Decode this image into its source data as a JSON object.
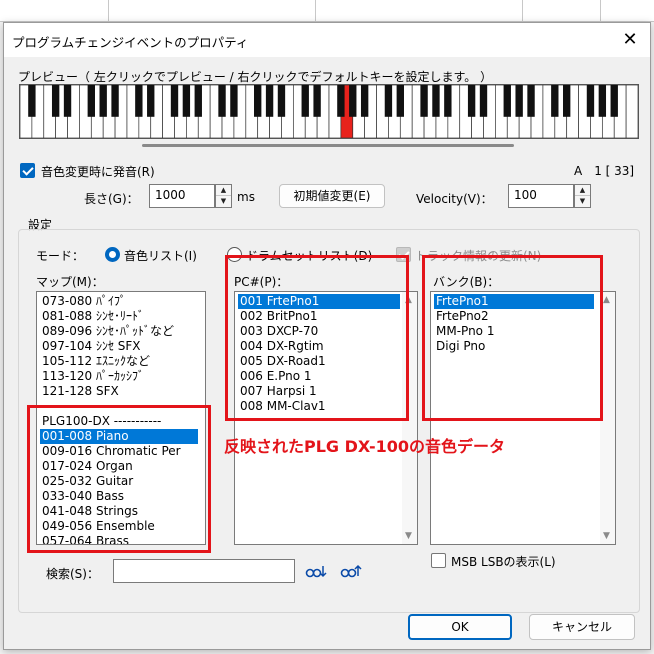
{
  "window": {
    "title": "プログラムチェンジイベントのプロパティ",
    "close_glyph": "✕"
  },
  "preview": {
    "label": "プレビュー（ 左クリックでプレビュー / 右クリックでデフォルトキーを設定します。 ）",
    "highlight_color": "#e8221c"
  },
  "sound_on_change": {
    "label": "音色変更時に発音(R)",
    "checked": true
  },
  "note_info": "A　1 [ 33]",
  "length": {
    "label": "長さ(G)：",
    "value": "1000",
    "unit": "ms"
  },
  "reset_button": "初期値変更(E)",
  "velocity": {
    "label": "Velocity(V)：",
    "value": "100"
  },
  "settings": {
    "label": "設定",
    "mode_label": "モード：",
    "mode_options": [
      "音色リスト(I)",
      "ドラムセットリスト(D)"
    ],
    "mode_selected": 0,
    "update_track": {
      "label": "トラック情報の更新(N)",
      "checked": true,
      "disabled": true
    }
  },
  "map": {
    "label": "マップ(M)：",
    "items": [
      "073-080 ﾊﾟｲﾌﾟ",
      "081-088 ｼﾝｾ･ﾘｰﾄﾞ",
      "089-096 ｼﾝｾ･ﾊﾟｯﾄﾞなど",
      "097-104 ｼﾝｾ SFX",
      "105-112 ｴｽﾆｯｸなど",
      "113-120 ﾊﾟｰｶｯｼﾌﾞ",
      "121-128 SFX"
    ],
    "items2": [
      "PLG100-DX -----------",
      "001-008 Piano",
      "009-016 Chromatic Per",
      "017-024 Organ",
      "025-032 Guitar",
      "033-040 Bass",
      "041-048 Strings",
      "049-056 Ensemble",
      "057-064 Brass"
    ],
    "selected": "001-008 Piano"
  },
  "pc": {
    "label": "PC#(P)：",
    "items": [
      "001 FrtePno1",
      "002 BritPno1",
      "003 DXCP-70",
      "004 DX-Rgtim",
      "005 DX-Road1",
      "006 E.Pno 1",
      "007 Harpsi 1",
      "008 MM-Clav1"
    ],
    "selected": 0
  },
  "bank": {
    "label": "バンク(B)：",
    "items": [
      "FrtePno1",
      "FrtePno2",
      "MM-Pno 1",
      "Digi Pno"
    ],
    "selected": 0
  },
  "annotation": {
    "text": "反映されたPLG DX-100の音色データ",
    "color": "#e3141a"
  },
  "msb_lsb": {
    "label": "MSB LSBの表示(L)",
    "checked": false
  },
  "search": {
    "label": "検索(S)：",
    "value": "",
    "prev_icon": "search-prev-icon",
    "next_icon": "search-next-icon"
  },
  "buttons": {
    "ok": "OK",
    "cancel": "キャンセル"
  }
}
